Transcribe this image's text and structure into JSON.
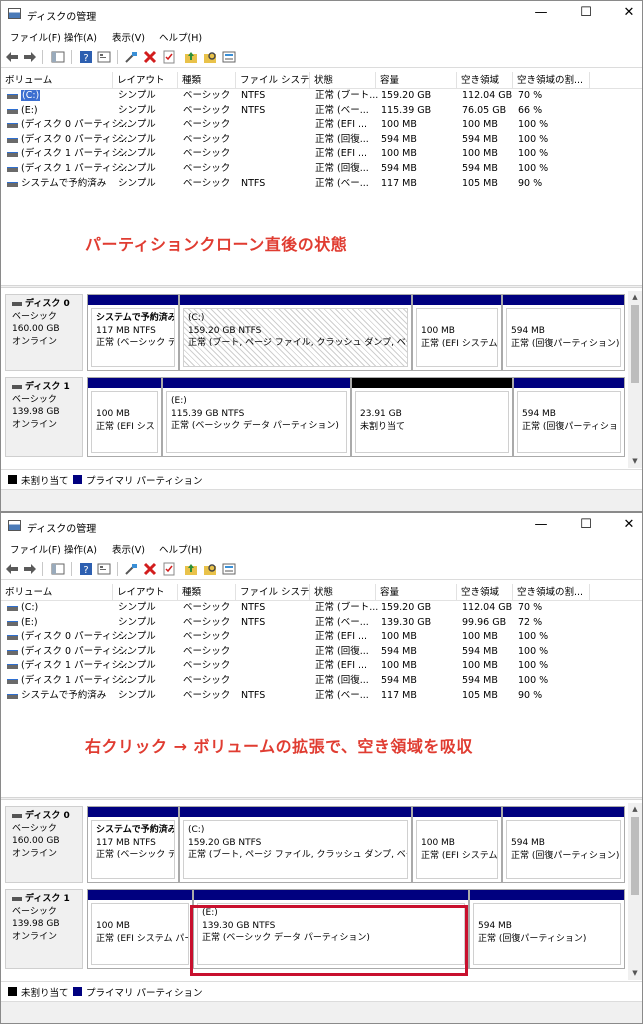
{
  "windows": [
    {
      "title": "ディスクの管理",
      "menu": [
        "ファイル(F)",
        "操作(A)",
        "表示(V)",
        "ヘルプ(H)"
      ],
      "columns": [
        "ボリューム",
        "レイアウト",
        "種類",
        "ファイル システム",
        "状態",
        "容量",
        "空き領域",
        "空き領域の割..."
      ],
      "rows": [
        {
          "name": "(C:)",
          "layout": "シンプル",
          "type": "ベーシック",
          "fs": "NTFS",
          "status": "正常 (ブート...",
          "capacity": "159.20 GB",
          "free": "112.04 GB",
          "pct": "70 %"
        },
        {
          "name": "(E:)",
          "layout": "シンプル",
          "type": "ベーシック",
          "fs": "NTFS",
          "status": "正常 (ベー...",
          "capacity": "115.39 GB",
          "free": "76.05 GB",
          "pct": "66 %"
        },
        {
          "name": "(ディスク 0 パーティシ...",
          "layout": "シンプル",
          "type": "ベーシック",
          "fs": "",
          "status": "正常 (EFI ...",
          "capacity": "100 MB",
          "free": "100 MB",
          "pct": "100 %"
        },
        {
          "name": "(ディスク 0 パーティシ...",
          "layout": "シンプル",
          "type": "ベーシック",
          "fs": "",
          "status": "正常 (回復...",
          "capacity": "594 MB",
          "free": "594 MB",
          "pct": "100 %"
        },
        {
          "name": "(ディスク 1 パーティシ...",
          "layout": "シンプル",
          "type": "ベーシック",
          "fs": "",
          "status": "正常 (EFI ...",
          "capacity": "100 MB",
          "free": "100 MB",
          "pct": "100 %"
        },
        {
          "name": "(ディスク 1 パーティシ...",
          "layout": "シンプル",
          "type": "ベーシック",
          "fs": "",
          "status": "正常 (回復...",
          "capacity": "594 MB",
          "free": "594 MB",
          "pct": "100 %"
        },
        {
          "name": "システムで予約済み",
          "layout": "シンプル",
          "type": "ベーシック",
          "fs": "NTFS",
          "status": "正常 (ベー...",
          "capacity": "117 MB",
          "free": "105 MB",
          "pct": "90 %"
        }
      ],
      "note": "パーティションクローン直後の状態",
      "disks": [
        {
          "name": "ディスク 0",
          "kind": "ベーシック",
          "size": "160.00 GB",
          "state": "オンライン",
          "partitions": [
            {
              "title": "システムで予約済み",
              "line1": "117 MB NTFS",
              "line2": "正常 (ベーシック デ"
            },
            {
              "title": "(C:)",
              "line1": "159.20 GB NTFS",
              "line2": "正常 (ブート, ページ ファイル, クラッシュ ダンプ, ベーシック"
            },
            {
              "title": "",
              "line1": "100 MB",
              "line2": "正常 (EFI システム"
            },
            {
              "title": "",
              "line1": "594 MB",
              "line2": "正常 (回復パーティション)"
            }
          ]
        },
        {
          "name": "ディスク 1",
          "kind": "ベーシック",
          "size": "139.98 GB",
          "state": "オンライン",
          "partitions": [
            {
              "title": "",
              "line1": "100 MB",
              "line2": "正常 (EFI シス"
            },
            {
              "title": "(E:)",
              "line1": "115.39 GB NTFS",
              "line2": "正常 (ベーシック データ パーティション)"
            },
            {
              "title": "",
              "line1": "23.91 GB",
              "line2": "未割り当て"
            },
            {
              "title": "",
              "line1": "594 MB",
              "line2": "正常 (回復パーティショ"
            }
          ]
        }
      ],
      "legend": [
        "未割り当て",
        "プライマリ パーティション"
      ]
    },
    {
      "title": "ディスクの管理",
      "menu": [
        "ファイル(F)",
        "操作(A)",
        "表示(V)",
        "ヘルプ(H)"
      ],
      "columns": [
        "ボリューム",
        "レイアウト",
        "種類",
        "ファイル システム",
        "状態",
        "容量",
        "空き領域",
        "空き領域の割..."
      ],
      "rows": [
        {
          "name": "(C:)",
          "layout": "シンプル",
          "type": "ベーシック",
          "fs": "NTFS",
          "status": "正常 (ブート...",
          "capacity": "159.20 GB",
          "free": "112.04 GB",
          "pct": "70 %"
        },
        {
          "name": "(E:)",
          "layout": "シンプル",
          "type": "ベーシック",
          "fs": "NTFS",
          "status": "正常 (ベー...",
          "capacity": "139.30 GB",
          "free": "99.96 GB",
          "pct": "72 %"
        },
        {
          "name": "(ディスク 0 パーティシ...",
          "layout": "シンプル",
          "type": "ベーシック",
          "fs": "",
          "status": "正常 (EFI ...",
          "capacity": "100 MB",
          "free": "100 MB",
          "pct": "100 %"
        },
        {
          "name": "(ディスク 0 パーティシ...",
          "layout": "シンプル",
          "type": "ベーシック",
          "fs": "",
          "status": "正常 (回復...",
          "capacity": "594 MB",
          "free": "594 MB",
          "pct": "100 %"
        },
        {
          "name": "(ディスク 1 パーティシ...",
          "layout": "シンプル",
          "type": "ベーシック",
          "fs": "",
          "status": "正常 (EFI ...",
          "capacity": "100 MB",
          "free": "100 MB",
          "pct": "100 %"
        },
        {
          "name": "(ディスク 1 パーティシ...",
          "layout": "シンプル",
          "type": "ベーシック",
          "fs": "",
          "status": "正常 (回復...",
          "capacity": "594 MB",
          "free": "594 MB",
          "pct": "100 %"
        },
        {
          "name": "システムで予約済み",
          "layout": "シンプル",
          "type": "ベーシック",
          "fs": "NTFS",
          "status": "正常 (ベー...",
          "capacity": "117 MB",
          "free": "105 MB",
          "pct": "90 %"
        }
      ],
      "note": "右クリック → ボリュームの拡張で、空き領域を吸収",
      "disks": [
        {
          "name": "ディスク 0",
          "kind": "ベーシック",
          "size": "160.00 GB",
          "state": "オンライン",
          "partitions": [
            {
              "title": "システムで予約済み",
              "line1": "117 MB NTFS",
              "line2": "正常 (ベーシック デ"
            },
            {
              "title": "(C:)",
              "line1": "159.20 GB NTFS",
              "line2": "正常 (ブート, ページ ファイル, クラッシュ ダンプ, ベーシック"
            },
            {
              "title": "",
              "line1": "100 MB",
              "line2": "正常 (EFI システム"
            },
            {
              "title": "",
              "line1": "594 MB",
              "line2": "正常 (回復パーティション)"
            }
          ]
        },
        {
          "name": "ディスク 1",
          "kind": "ベーシック",
          "size": "139.98 GB",
          "state": "オンライン",
          "partitions": [
            {
              "title": "",
              "line1": "100 MB",
              "line2": "正常 (EFI システム パー"
            },
            {
              "title": "(E:)",
              "line1": "139.30 GB NTFS",
              "line2": "正常 (ベーシック データ パーティション)"
            },
            {
              "title": "",
              "line1": "594 MB",
              "line2": "正常 (回復パーティション)"
            }
          ]
        }
      ],
      "legend": [
        "未割り当て",
        "プライマリ パーティション"
      ]
    }
  ],
  "colors": {
    "primary_partition": "#00007f",
    "unallocated": "#000000",
    "note_text": "#e03c31",
    "highlight_box": "#c8102e",
    "selected_volume": "#3c6fd0"
  },
  "icons": [
    "back-arrow-icon",
    "forward-arrow-icon",
    "console-tree-icon",
    "help-icon",
    "properties-icon",
    "connect-icon",
    "delete-icon",
    "checklist-icon",
    "folder-up-icon",
    "search-folder-icon",
    "view-icon"
  ]
}
